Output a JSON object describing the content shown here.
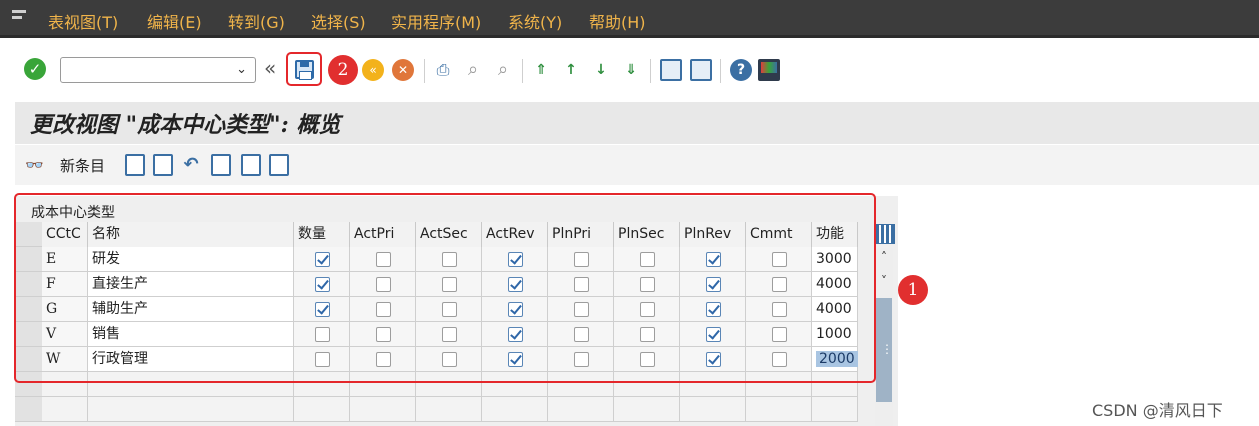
{
  "menubar": {
    "items": [
      {
        "label": "表视图(T)"
      },
      {
        "label": "编辑(E)"
      },
      {
        "label": "转到(G)"
      },
      {
        "label": "选择(S)"
      },
      {
        "label": "实用程序(M)"
      },
      {
        "label": "系统(Y)"
      },
      {
        "label": "帮助(H)"
      }
    ]
  },
  "toolbar": {
    "command_field_value": "",
    "annotation_2": "2",
    "annotation_1": "1"
  },
  "title": "更改视图 \"成本中心类型\": 概览",
  "app_toolbar": {
    "new_entries_label": "新条目"
  },
  "table": {
    "caption": "成本中心类型",
    "columns": [
      "CCtC",
      "名称",
      "数量",
      "ActPri",
      "ActSec",
      "ActRev",
      "PlnPri",
      "PlnSec",
      "PlnRev",
      "Cmmt",
      "功能"
    ],
    "rows": [
      {
        "cctc": "E",
        "name": "研发",
        "checks": [
          true,
          false,
          false,
          true,
          false,
          false,
          true,
          false
        ],
        "func": "3000"
      },
      {
        "cctc": "F",
        "name": "直接生产",
        "checks": [
          true,
          false,
          false,
          true,
          false,
          false,
          true,
          false
        ],
        "func": "4000"
      },
      {
        "cctc": "G",
        "name": "辅助生产",
        "checks": [
          true,
          false,
          false,
          true,
          false,
          false,
          true,
          false
        ],
        "func": "4000"
      },
      {
        "cctc": "V",
        "name": "销售",
        "checks": [
          false,
          false,
          false,
          true,
          false,
          false,
          true,
          false
        ],
        "func": "1000"
      },
      {
        "cctc": "W",
        "name": "行政管理",
        "checks": [
          false,
          false,
          false,
          true,
          false,
          false,
          true,
          false
        ],
        "func": "2000"
      }
    ]
  },
  "watermark": "CSDN @清风日下",
  "colors": {
    "menu_bg": "#3c3c3c",
    "menu_text": "#f0b44a",
    "highlight_red": "#e4272b",
    "check_blue": "#2f67a8"
  }
}
